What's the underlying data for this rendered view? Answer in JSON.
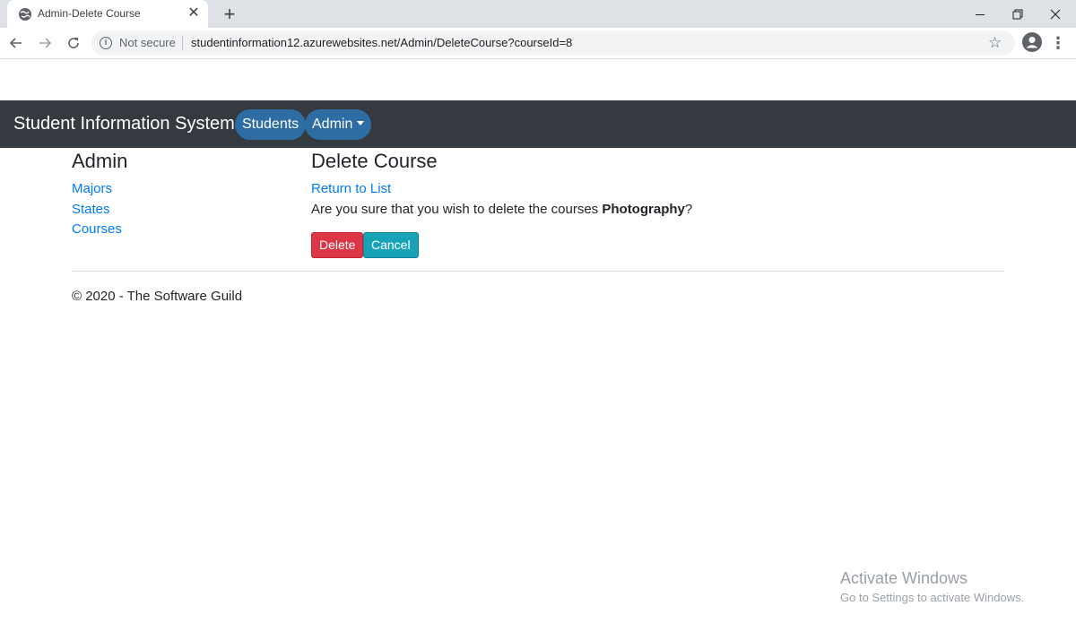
{
  "browser": {
    "tab_title": "Admin-Delete Course",
    "tab_close": "✕",
    "new_tab": "+",
    "security_label": "Not secure",
    "url": "studentinformation12.azurewebsites.net/Admin/DeleteCourse?courseId=8"
  },
  "navbar": {
    "brand": "Student Information System",
    "students_label": "Students",
    "admin_label": "Admin"
  },
  "sidebar": {
    "title": "Admin",
    "links": [
      {
        "label": "Majors"
      },
      {
        "label": "States"
      },
      {
        "label": "Courses"
      }
    ]
  },
  "main": {
    "title": "Delete Course",
    "return_link": "Return to List",
    "confirm_prefix": "Are you sure that you wish to delete the courses",
    "course_name": "Photography",
    "confirm_suffix": "?",
    "delete_label": "Delete",
    "cancel_label": "Cancel"
  },
  "footer": {
    "text": "© 2020 - The Software Guild"
  },
  "watermark": {
    "title": "Activate Windows",
    "subtitle": "Go to Settings to activate Windows."
  },
  "colors": {
    "navbar_bg": "#343a40",
    "pill_bg": "#2e6da4",
    "link": "#007bff",
    "delete_btn": "#dc3545",
    "cancel_btn": "#17a2b8"
  }
}
